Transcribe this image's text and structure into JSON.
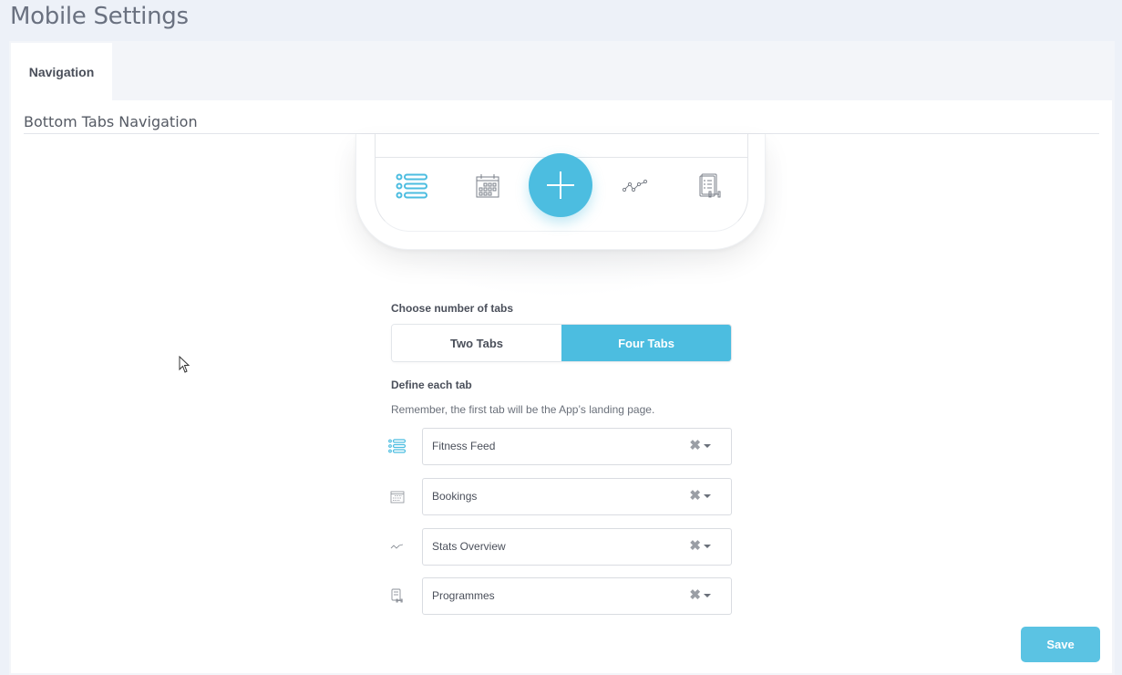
{
  "page": {
    "title": "Mobile Settings"
  },
  "tabs": [
    {
      "label": "Navigation",
      "active": true
    }
  ],
  "section": {
    "title": "Bottom Tabs Navigation"
  },
  "preview": {
    "icons": [
      "list-icon",
      "calendar-icon",
      "plus-icon",
      "stats-chart-icon",
      "programme-icon"
    ],
    "accent": "#4cbde0"
  },
  "tab_count": {
    "label": "Choose number of tabs",
    "options": [
      {
        "label": "Two Tabs",
        "selected": false
      },
      {
        "label": "Four Tabs",
        "selected": true
      }
    ]
  },
  "define": {
    "label": "Define each tab",
    "hint": "Remember, the first tab will be the App’s landing page.",
    "rows": [
      {
        "icon": "list-icon",
        "value": "Fitness Feed"
      },
      {
        "icon": "calendar-icon",
        "value": "Bookings"
      },
      {
        "icon": "stats-chart-icon",
        "value": "Stats Overview"
      },
      {
        "icon": "programme-icon",
        "value": "Programmes"
      }
    ],
    "clear_glyph": "✖"
  },
  "actions": {
    "save_label": "Save"
  }
}
